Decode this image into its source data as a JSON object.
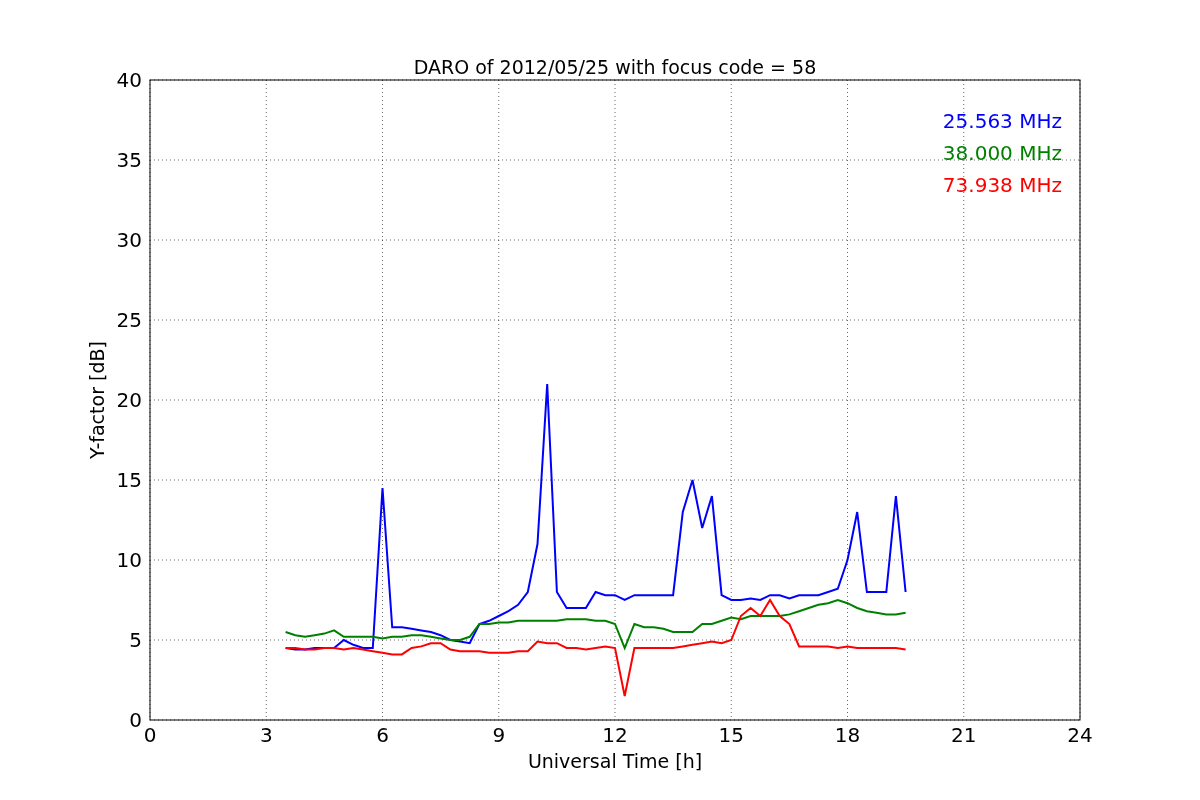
{
  "figure": {
    "chart_data": {
      "type": "line",
      "title": "DARO of 2012/05/25 with focus code = 58",
      "xlabel": "Universal Time [h]",
      "ylabel": "Y-factor [dB]",
      "x": [
        3.5,
        3.75,
        4,
        4.25,
        4.5,
        4.75,
        5,
        5.25,
        5.5,
        5.75,
        6,
        6.25,
        6.5,
        6.75,
        7,
        7.25,
        7.5,
        7.75,
        8,
        8.25,
        8.5,
        8.75,
        9,
        9.25,
        9.5,
        9.75,
        10,
        10.25,
        10.5,
        10.75,
        11,
        11.25,
        11.5,
        11.75,
        12,
        12.25,
        12.5,
        12.75,
        13,
        13.25,
        13.5,
        13.75,
        14,
        14.25,
        14.5,
        14.75,
        15,
        15.25,
        15.5,
        15.75,
        16,
        16.25,
        16.5,
        16.75,
        17,
        17.25,
        17.5,
        17.75,
        18,
        18.25,
        18.5,
        18.75,
        19,
        19.25,
        19.5
      ],
      "series": [
        {
          "name": "25.563 MHz",
          "color": "#0000ff",
          "values": [
            4.5,
            4.4,
            4.4,
            4.5,
            4.5,
            4.5,
            5.0,
            4.7,
            4.5,
            4.5,
            14.5,
            5.8,
            5.8,
            5.7,
            5.6,
            5.5,
            5.3,
            5.0,
            4.9,
            4.8,
            6.0,
            6.2,
            6.5,
            6.8,
            7.2,
            8.0,
            11.0,
            21.0,
            8.0,
            7.0,
            7.0,
            7.0,
            8.0,
            7.8,
            7.8,
            7.5,
            7.8,
            7.8,
            7.8,
            7.8,
            7.8,
            13.0,
            15.0,
            12.0,
            14.0,
            7.8,
            7.5,
            7.5,
            7.6,
            7.5,
            7.8,
            7.8,
            7.6,
            7.8,
            7.8,
            7.8,
            8.0,
            8.2,
            10.0,
            13.0,
            8.0,
            8.0,
            8.0,
            14.0,
            8.0
          ]
        },
        {
          "name": "38.000 MHz",
          "color": "#008000",
          "values": [
            5.5,
            5.3,
            5.2,
            5.3,
            5.4,
            5.6,
            5.2,
            5.2,
            5.2,
            5.2,
            5.1,
            5.2,
            5.2,
            5.3,
            5.3,
            5.2,
            5.1,
            5.0,
            5.0,
            5.2,
            6.0,
            6.0,
            6.1,
            6.1,
            6.2,
            6.2,
            6.2,
            6.2,
            6.2,
            6.3,
            6.3,
            6.3,
            6.2,
            6.2,
            6.0,
            4.5,
            6.0,
            5.8,
            5.8,
            5.7,
            5.5,
            5.5,
            5.5,
            6.0,
            6.0,
            6.2,
            6.4,
            6.3,
            6.5,
            6.5,
            6.5,
            6.5,
            6.6,
            6.8,
            7.0,
            7.2,
            7.3,
            7.5,
            7.3,
            7.0,
            6.8,
            6.7,
            6.6,
            6.6,
            6.7
          ]
        },
        {
          "name": "73.938 MHz",
          "color": "#ff0000",
          "values": [
            4.5,
            4.5,
            4.4,
            4.4,
            4.5,
            4.5,
            4.4,
            4.5,
            4.4,
            4.3,
            4.2,
            4.1,
            4.1,
            4.5,
            4.6,
            4.8,
            4.8,
            4.4,
            4.3,
            4.3,
            4.3,
            4.2,
            4.2,
            4.2,
            4.3,
            4.3,
            4.9,
            4.8,
            4.8,
            4.5,
            4.5,
            4.4,
            4.5,
            4.6,
            4.5,
            1.5,
            4.5,
            4.5,
            4.5,
            4.5,
            4.5,
            4.6,
            4.7,
            4.8,
            4.9,
            4.8,
            5.0,
            6.5,
            7.0,
            6.5,
            7.5,
            6.5,
            6.0,
            4.6,
            4.6,
            4.6,
            4.6,
            4.5,
            4.6,
            4.5,
            4.5,
            4.5,
            4.5,
            4.5,
            4.4
          ]
        }
      ],
      "grid": true,
      "xlim": [
        0,
        24
      ],
      "ylim": [
        0,
        40
      ],
      "xticks": [
        0,
        3,
        6,
        9,
        12,
        15,
        18,
        21,
        24
      ],
      "yticks": [
        0,
        5,
        10,
        15,
        20,
        25,
        30,
        35,
        40
      ]
    }
  }
}
